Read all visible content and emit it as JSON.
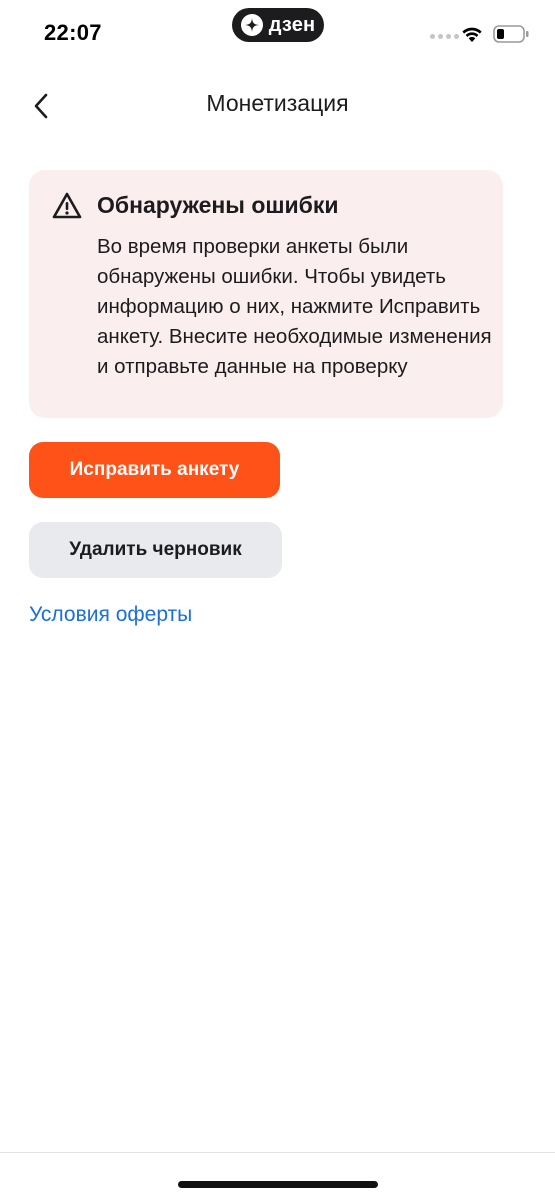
{
  "status_bar": {
    "time": "22:07",
    "app_label": "дзен"
  },
  "nav": {
    "title": "Монетизация"
  },
  "error_card": {
    "title": "Обнаружены ошибки",
    "body": "Во время проверки анкеты были обнаружены ошибки. Чтобы увидеть информацию о них, нажмите Исправить анкету. Внесите необходимые изменения и отправьте данные на проверку",
    "icon": "warning-icon"
  },
  "actions": {
    "fix_label": "Исправить анкету",
    "delete_label": "Удалить черновик",
    "offer_link": "Условия оферты"
  },
  "colors": {
    "accent": "#ff5219",
    "card_bg": "#fbeeee",
    "secondary_bg": "#e9eaee",
    "link": "#1a6fd8"
  }
}
